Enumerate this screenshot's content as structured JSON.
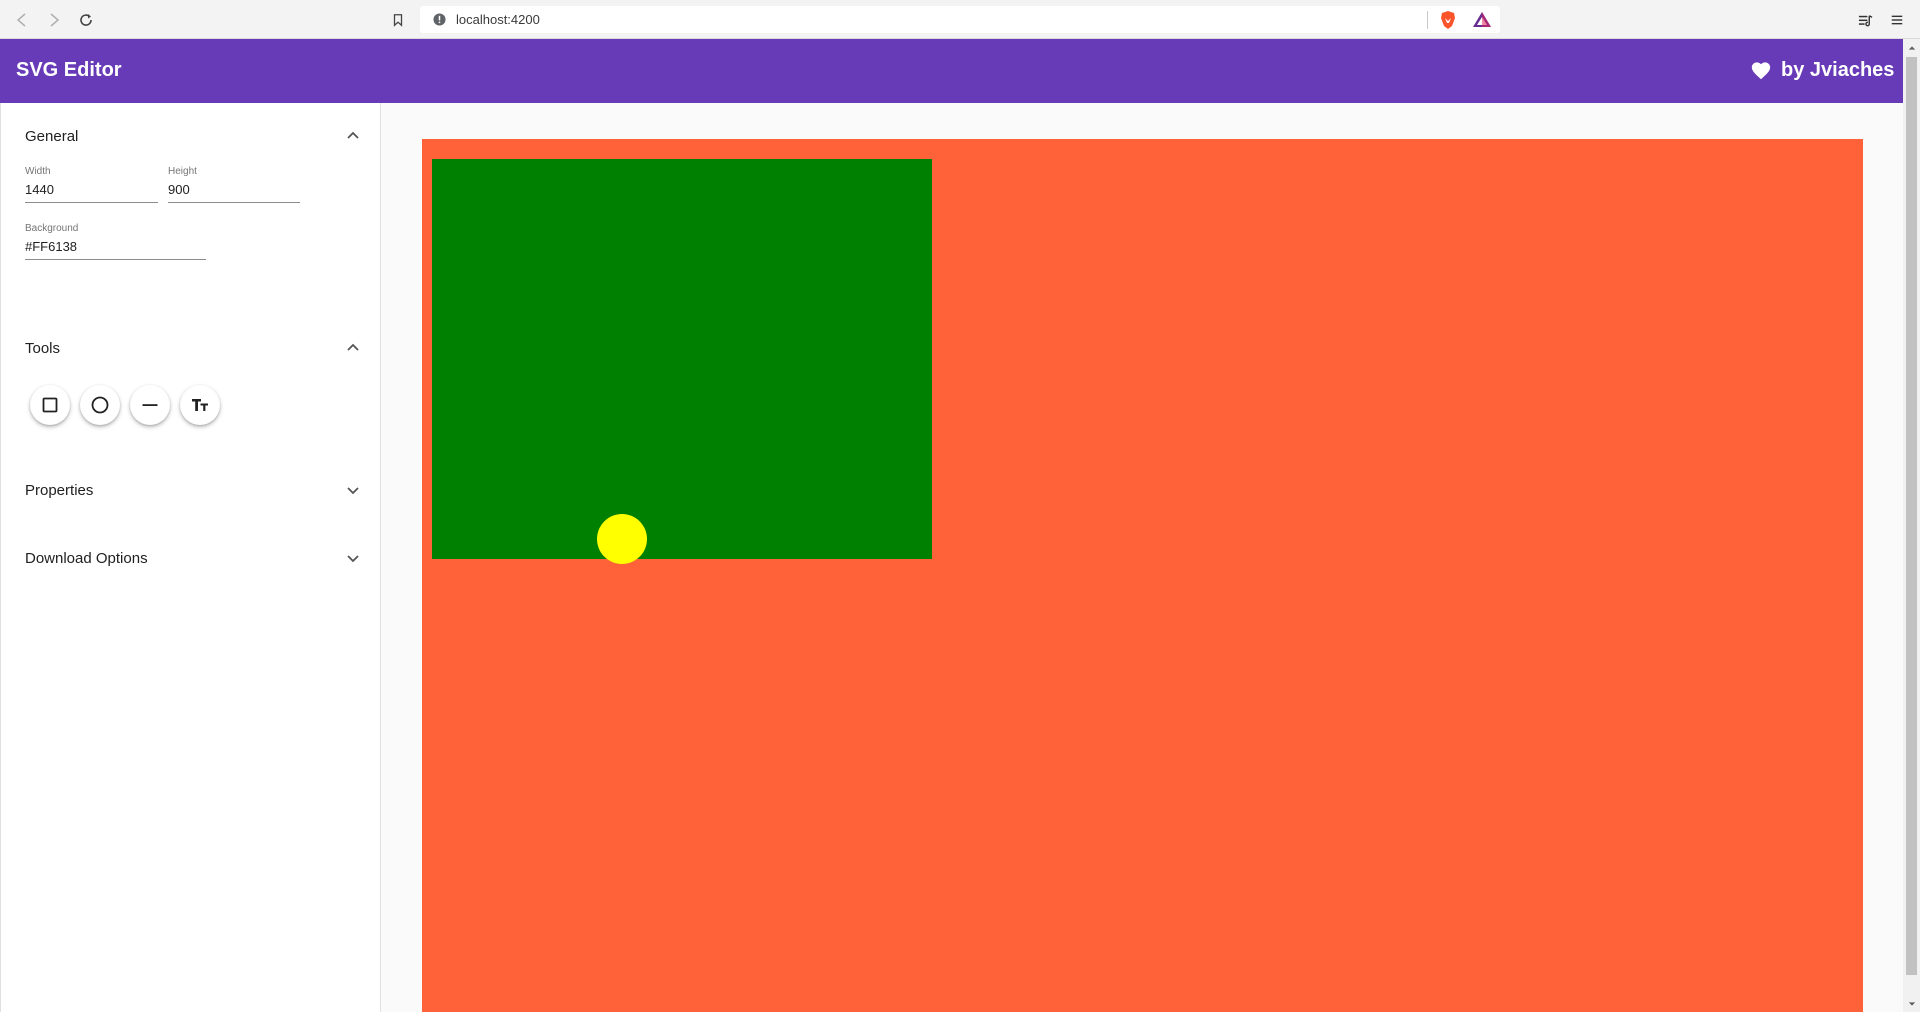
{
  "browser": {
    "url": "localhost:4200",
    "icons": [
      "back-icon",
      "forward-icon",
      "reload-icon",
      "bookmark-icon",
      "site-info-icon",
      "brave-shields-icon",
      "brave-rewards-icon",
      "playlist-icon",
      "menu-icon"
    ]
  },
  "header": {
    "title": "SVG Editor",
    "credit": "by Jviaches",
    "credit_icon": "heart-icon"
  },
  "sidebar": {
    "general": {
      "title": "General",
      "width_label": "Width",
      "width_value": "1440",
      "height_label": "Height",
      "height_value": "900",
      "background_label": "Background",
      "background_value": "#FF6138"
    },
    "tools": {
      "title": "Tools",
      "items": [
        "rectangle-tool",
        "circle-tool",
        "line-tool",
        "text-tool"
      ]
    },
    "properties": {
      "title": "Properties"
    },
    "download": {
      "title": "Download Options"
    }
  },
  "canvas": {
    "background": "#FF6138",
    "rect_fill": "#008000",
    "circle_fill": "#FFFF00"
  },
  "colors": {
    "accent": "#673ab7"
  }
}
